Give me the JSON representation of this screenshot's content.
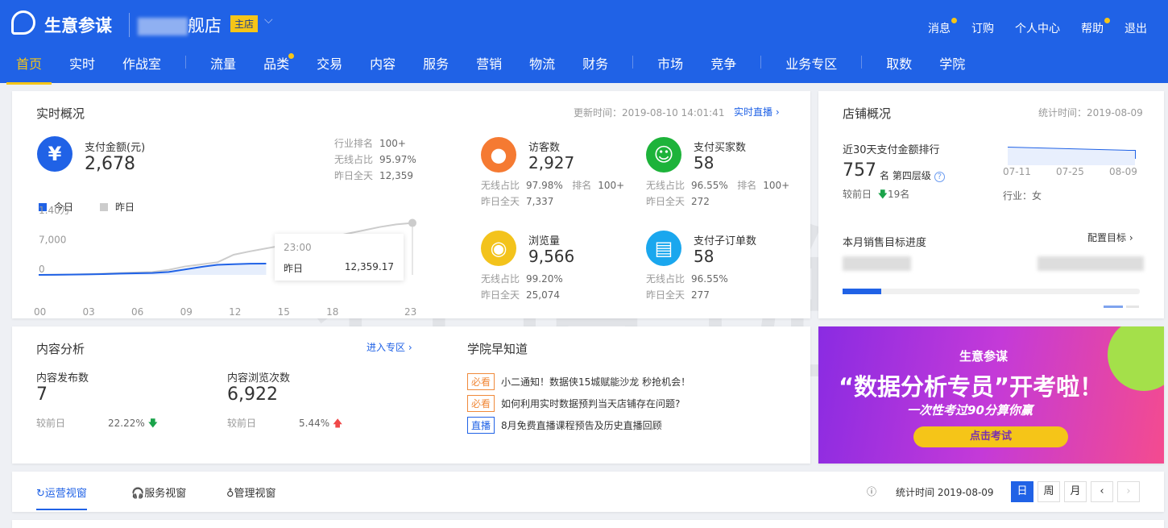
{
  "header": {
    "brand": "生意参谋",
    "shop_suffix": "舰店",
    "shop_badge": "主店",
    "top_links": [
      {
        "label": "消息",
        "dot": true
      },
      {
        "label": "订购",
        "dot": false
      },
      {
        "label": "个人中心",
        "dot": false
      },
      {
        "label": "帮助",
        "dot": true
      },
      {
        "label": "退出",
        "dot": false
      }
    ],
    "nav": [
      {
        "label": "首页",
        "active": true
      },
      {
        "label": "实时"
      },
      {
        "label": "作战室"
      },
      {
        "sep": true
      },
      {
        "label": "流量"
      },
      {
        "label": "品类",
        "dot": true
      },
      {
        "label": "交易"
      },
      {
        "label": "内容"
      },
      {
        "label": "服务"
      },
      {
        "label": "营销"
      },
      {
        "label": "物流"
      },
      {
        "label": "财务"
      },
      {
        "sep": true
      },
      {
        "label": "市场"
      },
      {
        "label": "竞争"
      },
      {
        "sep": true
      },
      {
        "label": "业务专区"
      },
      {
        "sep": true
      },
      {
        "label": "取数"
      },
      {
        "label": "学院"
      }
    ]
  },
  "realtime": {
    "title": "实时概况",
    "update": "更新时间：2019-08-10 14:01:41",
    "live": "实时直播 ›",
    "pay": {
      "label": "支付金额(元)",
      "value": "2,678",
      "rank_label": "行业排名",
      "rank": "100+",
      "wireless_label": "无线占比",
      "wireless": "95.97%",
      "yday_label": "昨日全天",
      "yday": "12,359"
    },
    "metrics": [
      {
        "label": "访客数",
        "value": "2,927",
        "wireless": "97.98%",
        "rank": "100+",
        "yday": "7,337",
        "color": "#f57a32",
        "icon": "footprint-icon"
      },
      {
        "label": "支付买家数",
        "value": "58",
        "wireless": "96.55%",
        "rank": "100+",
        "yday": "272",
        "color": "#1db33a",
        "icon": "users-icon"
      },
      {
        "label": "浏览量",
        "value": "9,566",
        "wireless": "99.20%",
        "yday": "25,074",
        "color": "#f3c31c",
        "icon": "eye-icon"
      },
      {
        "label": "支付子订单数",
        "value": "58",
        "wireless": "96.55%",
        "yday": "277",
        "color": "#1aa7ee",
        "icon": "clipboard-icon"
      }
    ],
    "wl": "无线占比",
    "rk": "排名",
    "yd": "昨日全天",
    "tooltip": {
      "time": "23:00",
      "series": "昨日",
      "value": "12,359.17"
    }
  },
  "chart_data": {
    "type": "line",
    "x": [
      "00",
      "01",
      "02",
      "03",
      "04",
      "05",
      "06",
      "07",
      "08",
      "09",
      "10",
      "11",
      "12",
      "13",
      "14",
      "15",
      "16",
      "17",
      "18",
      "19",
      "20",
      "21",
      "22",
      "23"
    ],
    "xticks": [
      "00",
      "03",
      "06",
      "09",
      "12",
      "15",
      "18",
      "23"
    ],
    "yticks": [
      "0",
      "7,000",
      "1.40万"
    ],
    "ylim": [
      0,
      14000
    ],
    "legend_placement": "top-left",
    "series": [
      {
        "name": "今日",
        "color": "#2062e6",
        "values": [
          0,
          30,
          60,
          120,
          200,
          300,
          380,
          450,
          700,
          1300,
          1900,
          2400,
          2550,
          2650,
          2678
        ]
      },
      {
        "name": "昨日",
        "color": "#cccccc",
        "values": [
          0,
          50,
          100,
          200,
          300,
          450,
          600,
          700,
          1200,
          2000,
          2500,
          3000,
          4800,
          5600,
          6300,
          7000,
          7600,
          8300,
          9000,
          9800,
          10600,
          11400,
          12000,
          12359
        ]
      }
    ]
  },
  "store": {
    "title": "店铺概况",
    "stat": "统计时间：2019-08-09",
    "rank_title": "近30天支付金额排行",
    "rank": "757",
    "rank_unit": "名",
    "tier": "第四层级",
    "cmp_label": "较前日",
    "cmp": "19名",
    "industry": "行业：女",
    "trend_ticks": [
      "07-11",
      "07-25",
      "08-09"
    ],
    "goal_title": "本月销售目标进度",
    "goal_link": "配置目标 ›",
    "goal_progress": 0.13
  },
  "content": {
    "title": "内容分析",
    "link": "进入专区 ›",
    "items": [
      {
        "label": "内容发布数",
        "value": "7",
        "cmp_label": "较前日",
        "cmp": "22.22%",
        "dir": "down"
      },
      {
        "label": "内容浏览次数",
        "value": "6,922",
        "cmp_label": "较前日",
        "cmp": "5.44%",
        "dir": "up"
      }
    ]
  },
  "academy": {
    "title": "学院早知道",
    "news": [
      {
        "tag": "必看",
        "text": "小二通知！数据侠15城赋能沙龙 秒抢机会！"
      },
      {
        "tag": "必看",
        "text": "如何利用实时数据预判当天店铺存在问题?"
      },
      {
        "tag": "直播",
        "text": "8月免费直播课程预告及历史直播回顾"
      }
    ]
  },
  "banner": {
    "brand": "生意参谋",
    "headline": "“数据分析专员”开考啦！",
    "sub": "一次性考过90分算你赢",
    "cta": "点击考试"
  },
  "views": {
    "tabs": [
      "运营视窗",
      "服务视窗",
      "管理视窗"
    ],
    "stat": "统计时间 2019-08-09",
    "periods": [
      "日",
      "周",
      "月"
    ],
    "prev": "‹",
    "next": "›"
  },
  "watermark": "有道说"
}
